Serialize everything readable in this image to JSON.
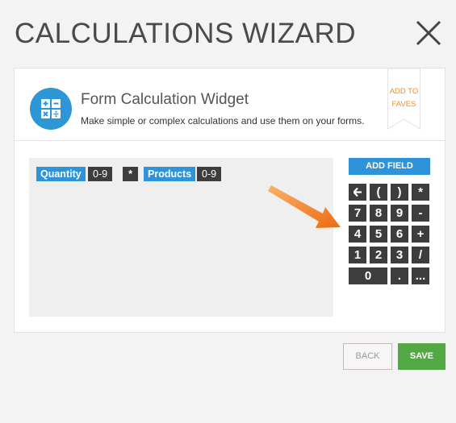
{
  "wizard": {
    "title": "CALCULATIONS WIZARD"
  },
  "widget": {
    "name": "Form Calculation Widget",
    "description": "Make simple or complex calculations and use them on your forms.",
    "favorite_label_line1": "ADD TO",
    "favorite_label_line2": "FAVES",
    "icon": "calculator-icon"
  },
  "formula": {
    "tokens": [
      {
        "type": "field",
        "label": "Quantity",
        "range": "0-9"
      },
      {
        "type": "operator",
        "label": "*"
      },
      {
        "type": "field",
        "label": "Products",
        "range": "0-9"
      }
    ]
  },
  "keypad": {
    "add_field_label": "ADD FIELD",
    "rows": [
      [
        "backspace",
        "(",
        ")",
        "*"
      ],
      [
        "7",
        "8",
        "9",
        "-"
      ],
      [
        "4",
        "5",
        "6",
        "+"
      ],
      [
        "1",
        "2",
        "3",
        "/"
      ],
      [
        "0",
        ".",
        "..."
      ]
    ]
  },
  "footer": {
    "back_label": "BACK",
    "save_label": "SAVE"
  },
  "colors": {
    "accent_blue": "#2e93d8",
    "dark_key": "#3d3d3d",
    "save_green": "#52a943",
    "faves_orange": "#ee8d33",
    "pointer_arrow": "#f07a22"
  }
}
